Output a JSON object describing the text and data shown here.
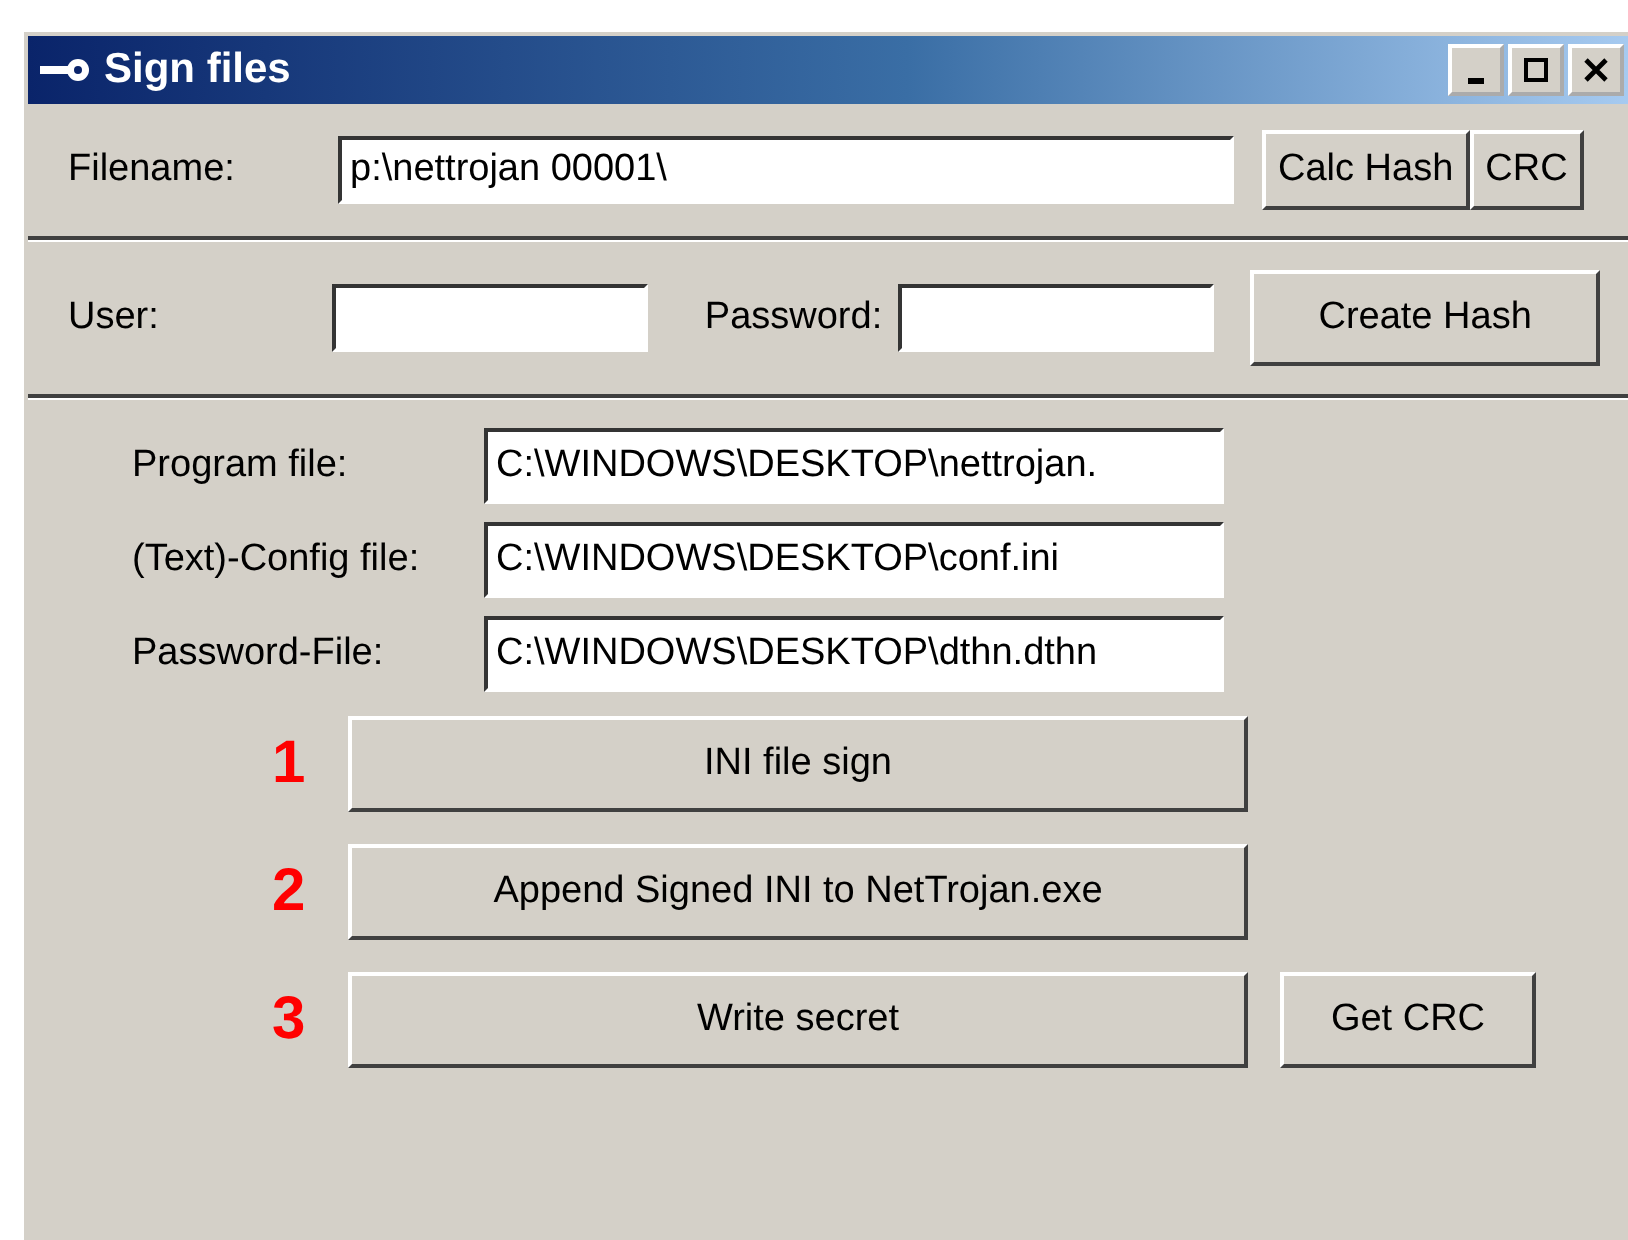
{
  "window": {
    "title": "Sign files"
  },
  "filename": {
    "label": "Filename:",
    "value": "p:\\nettrojan 00001\\",
    "buttons": [
      "Calc Hash",
      "CRC"
    ]
  },
  "credentials": {
    "user_label": "User:",
    "password_label": "Password:",
    "button": "Create Hash"
  },
  "files": [
    {
      "label": "Program file:",
      "value": "C:\\WINDOWS\\DESKTOP\\nettrojan."
    },
    {
      "label": "(Text)-Config file:",
      "value": "C:\\WINDOWS\\DESKTOP\\conf.ini"
    },
    {
      "label": "Password-File:",
      "value": "C:\\WINDOWS\\DESKTOP\\dthn.dthn"
    }
  ],
  "steps": [
    {
      "number": "1",
      "label": "INI file sign"
    },
    {
      "number": "2",
      "label": "Append Signed INI to NetTrojan.exe"
    },
    {
      "number": "3",
      "label": "Write secret",
      "side_button": "Get CRC"
    }
  ]
}
